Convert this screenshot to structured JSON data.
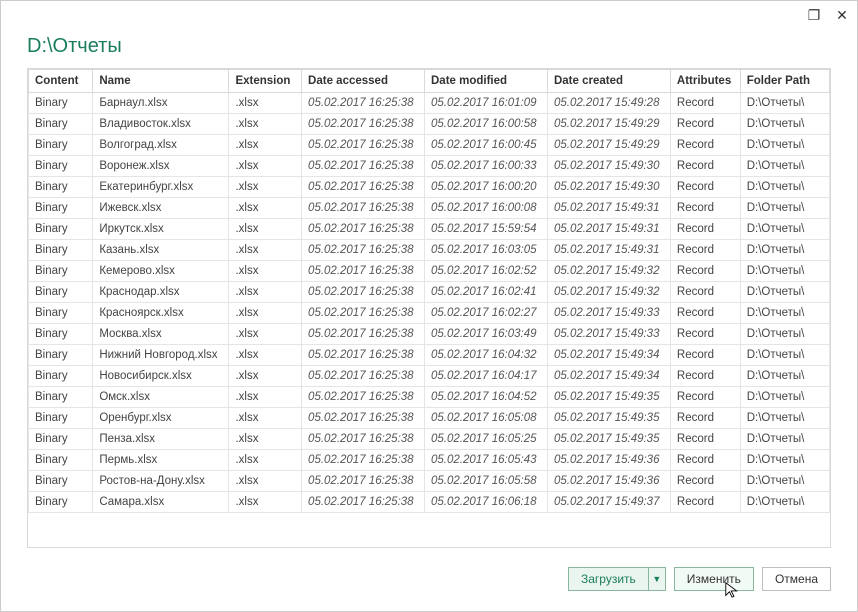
{
  "window": {
    "maximize_glyph": "❐",
    "close_glyph": "✕"
  },
  "title": "D:\\Отчеты",
  "columns": [
    "Content",
    "Name",
    "Extension",
    "Date accessed",
    "Date modified",
    "Date created",
    "Attributes",
    "Folder Path"
  ],
  "rows": [
    {
      "content": "Binary",
      "name": "Барнаул.xlsx",
      "ext": ".xlsx",
      "acc": "05.02.2017 16:25:38",
      "mod": "05.02.2017 16:01:09",
      "cre": "05.02.2017 15:49:28",
      "attr": "Record",
      "path": "D:\\Отчеты\\"
    },
    {
      "content": "Binary",
      "name": "Владивосток.xlsx",
      "ext": ".xlsx",
      "acc": "05.02.2017 16:25:38",
      "mod": "05.02.2017 16:00:58",
      "cre": "05.02.2017 15:49:29",
      "attr": "Record",
      "path": "D:\\Отчеты\\"
    },
    {
      "content": "Binary",
      "name": "Волгоград.xlsx",
      "ext": ".xlsx",
      "acc": "05.02.2017 16:25:38",
      "mod": "05.02.2017 16:00:45",
      "cre": "05.02.2017 15:49:29",
      "attr": "Record",
      "path": "D:\\Отчеты\\"
    },
    {
      "content": "Binary",
      "name": "Воронеж.xlsx",
      "ext": ".xlsx",
      "acc": "05.02.2017 16:25:38",
      "mod": "05.02.2017 16:00:33",
      "cre": "05.02.2017 15:49:30",
      "attr": "Record",
      "path": "D:\\Отчеты\\"
    },
    {
      "content": "Binary",
      "name": "Екатеринбург.xlsx",
      "ext": ".xlsx",
      "acc": "05.02.2017 16:25:38",
      "mod": "05.02.2017 16:00:20",
      "cre": "05.02.2017 15:49:30",
      "attr": "Record",
      "path": "D:\\Отчеты\\"
    },
    {
      "content": "Binary",
      "name": "Ижевск.xlsx",
      "ext": ".xlsx",
      "acc": "05.02.2017 16:25:38",
      "mod": "05.02.2017 16:00:08",
      "cre": "05.02.2017 15:49:31",
      "attr": "Record",
      "path": "D:\\Отчеты\\"
    },
    {
      "content": "Binary",
      "name": "Иркутск.xlsx",
      "ext": ".xlsx",
      "acc": "05.02.2017 16:25:38",
      "mod": "05.02.2017 15:59:54",
      "cre": "05.02.2017 15:49:31",
      "attr": "Record",
      "path": "D:\\Отчеты\\"
    },
    {
      "content": "Binary",
      "name": "Казань.xlsx",
      "ext": ".xlsx",
      "acc": "05.02.2017 16:25:38",
      "mod": "05.02.2017 16:03:05",
      "cre": "05.02.2017 15:49:31",
      "attr": "Record",
      "path": "D:\\Отчеты\\"
    },
    {
      "content": "Binary",
      "name": "Кемерово.xlsx",
      "ext": ".xlsx",
      "acc": "05.02.2017 16:25:38",
      "mod": "05.02.2017 16:02:52",
      "cre": "05.02.2017 15:49:32",
      "attr": "Record",
      "path": "D:\\Отчеты\\"
    },
    {
      "content": "Binary",
      "name": "Краснодар.xlsx",
      "ext": ".xlsx",
      "acc": "05.02.2017 16:25:38",
      "mod": "05.02.2017 16:02:41",
      "cre": "05.02.2017 15:49:32",
      "attr": "Record",
      "path": "D:\\Отчеты\\"
    },
    {
      "content": "Binary",
      "name": "Красноярск.xlsx",
      "ext": ".xlsx",
      "acc": "05.02.2017 16:25:38",
      "mod": "05.02.2017 16:02:27",
      "cre": "05.02.2017 15:49:33",
      "attr": "Record",
      "path": "D:\\Отчеты\\"
    },
    {
      "content": "Binary",
      "name": "Москва.xlsx",
      "ext": ".xlsx",
      "acc": "05.02.2017 16:25:38",
      "mod": "05.02.2017 16:03:49",
      "cre": "05.02.2017 15:49:33",
      "attr": "Record",
      "path": "D:\\Отчеты\\"
    },
    {
      "content": "Binary",
      "name": "Нижний Новгород.xlsx",
      "ext": ".xlsx",
      "acc": "05.02.2017 16:25:38",
      "mod": "05.02.2017 16:04:32",
      "cre": "05.02.2017 15:49:34",
      "attr": "Record",
      "path": "D:\\Отчеты\\"
    },
    {
      "content": "Binary",
      "name": "Новосибирск.xlsx",
      "ext": ".xlsx",
      "acc": "05.02.2017 16:25:38",
      "mod": "05.02.2017 16:04:17",
      "cre": "05.02.2017 15:49:34",
      "attr": "Record",
      "path": "D:\\Отчеты\\"
    },
    {
      "content": "Binary",
      "name": "Омск.xlsx",
      "ext": ".xlsx",
      "acc": "05.02.2017 16:25:38",
      "mod": "05.02.2017 16:04:52",
      "cre": "05.02.2017 15:49:35",
      "attr": "Record",
      "path": "D:\\Отчеты\\"
    },
    {
      "content": "Binary",
      "name": "Оренбург.xlsx",
      "ext": ".xlsx",
      "acc": "05.02.2017 16:25:38",
      "mod": "05.02.2017 16:05:08",
      "cre": "05.02.2017 15:49:35",
      "attr": "Record",
      "path": "D:\\Отчеты\\"
    },
    {
      "content": "Binary",
      "name": "Пенза.xlsx",
      "ext": ".xlsx",
      "acc": "05.02.2017 16:25:38",
      "mod": "05.02.2017 16:05:25",
      "cre": "05.02.2017 15:49:35",
      "attr": "Record",
      "path": "D:\\Отчеты\\"
    },
    {
      "content": "Binary",
      "name": "Пермь.xlsx",
      "ext": ".xlsx",
      "acc": "05.02.2017 16:25:38",
      "mod": "05.02.2017 16:05:43",
      "cre": "05.02.2017 15:49:36",
      "attr": "Record",
      "path": "D:\\Отчеты\\"
    },
    {
      "content": "Binary",
      "name": "Ростов-на-Дону.xlsx",
      "ext": ".xlsx",
      "acc": "05.02.2017 16:25:38",
      "mod": "05.02.2017 16:05:58",
      "cre": "05.02.2017 15:49:36",
      "attr": "Record",
      "path": "D:\\Отчеты\\"
    },
    {
      "content": "Binary",
      "name": "Самара.xlsx",
      "ext": ".xlsx",
      "acc": "05.02.2017 16:25:38",
      "mod": "05.02.2017 16:06:18",
      "cre": "05.02.2017 15:49:37",
      "attr": "Record",
      "path": "D:\\Отчеты\\"
    }
  ],
  "footer": {
    "load_label": "Загрузить",
    "load_caret": "▼",
    "edit_label": "Изменить",
    "cancel_label": "Отмена"
  }
}
